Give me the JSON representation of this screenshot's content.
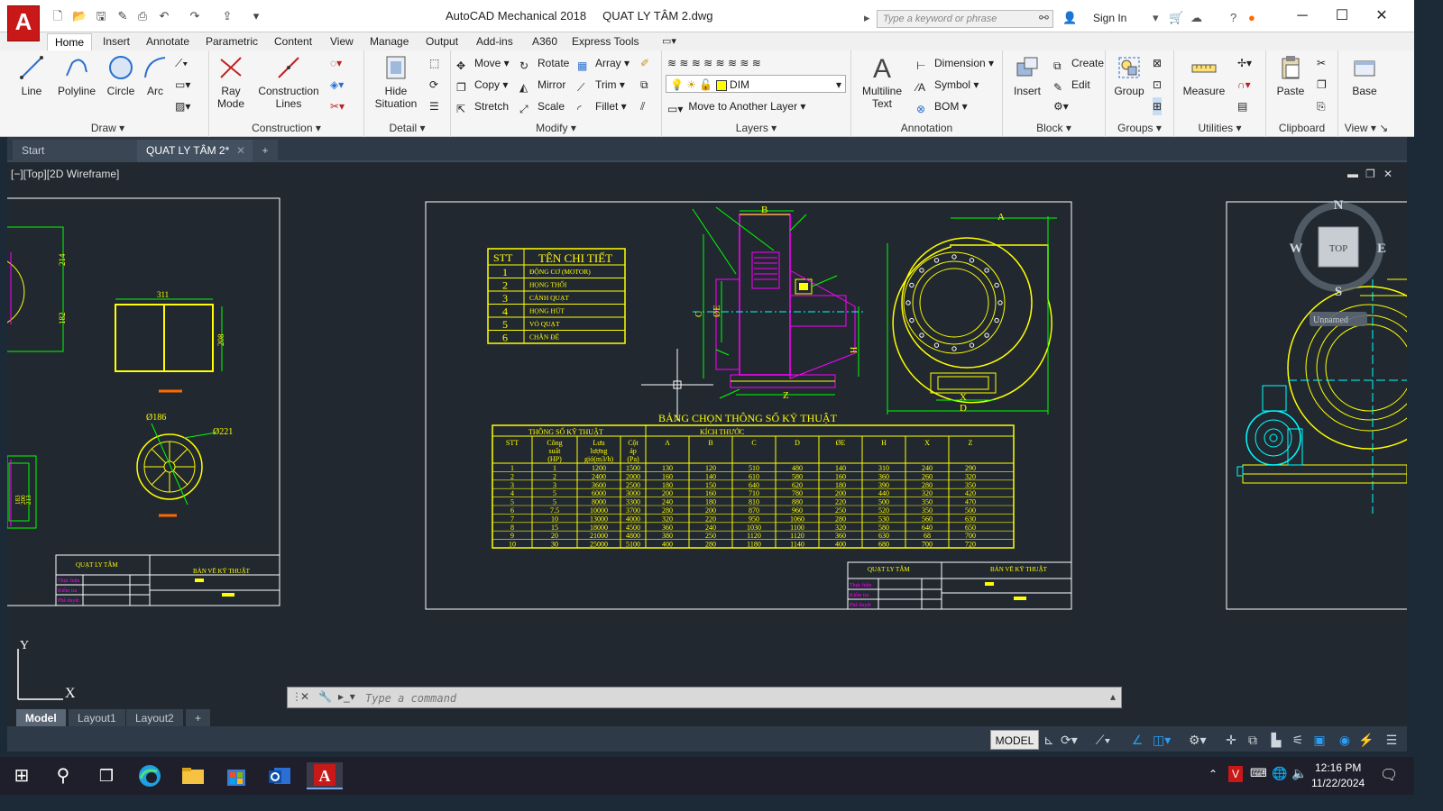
{
  "window": {
    "app_letter": "A",
    "title": "AutoCAD Mechanical 2018     QUAT LY TÂM 2.dwg",
    "search_placeholder": "Type a keyword or phrase",
    "sign_in": "Sign In"
  },
  "ribbon_tabs": [
    "Home",
    "Insert",
    "Annotate",
    "Parametric",
    "Content",
    "View",
    "Manage",
    "Output",
    "Add-ins",
    "A360",
    "Express Tools"
  ],
  "ribbon": {
    "draw": {
      "label": "Draw",
      "line": "Line",
      "polyline": "Polyline",
      "circle": "Circle",
      "arc": "Arc"
    },
    "construction": {
      "label": "Construction",
      "ray_1": "Ray",
      "ray_2": "Mode",
      "cl_1": "Construction",
      "cl_2": "Lines"
    },
    "detail": {
      "label": "Detail",
      "hide_1": "Hide",
      "hide_2": "Situation"
    },
    "modify": {
      "label": "Modify",
      "move": "Move",
      "rotate": "Rotate",
      "array": "Array",
      "copy": "Copy",
      "mirror": "Mirror",
      "trim": "Trim",
      "stretch": "Stretch",
      "scale": "Scale",
      "fillet": "Fillet"
    },
    "layers": {
      "label": "Layers",
      "current_layer": "DIM",
      "move_to_layer": "Move to Another Layer"
    },
    "annotation": {
      "label": "Annotation",
      "mtext_1": "Multiline",
      "mtext_2": "Text",
      "dimension": "Dimension",
      "symbol": "Symbol",
      "bom": "BOM"
    },
    "block": {
      "label": "Block",
      "insert": "Insert",
      "create": "Create",
      "edit": "Edit"
    },
    "groups": {
      "label": "Groups",
      "group": "Group"
    },
    "utilities": {
      "label": "Utilities",
      "measure": "Measure"
    },
    "clipboard": {
      "label": "Clipboard",
      "paste": "Paste"
    },
    "view": {
      "label": "View",
      "base": "Base"
    }
  },
  "doc_tabs": {
    "start": "Start",
    "active": "QUAT LY TÂM 2*"
  },
  "viewport": {
    "label": "[−][Top][2D Wireframe]",
    "viewcube": {
      "n": "N",
      "s": "S",
      "e": "E",
      "w": "W",
      "top": "TOP",
      "wcs": "Unnamed"
    },
    "ucs": {
      "x": "X",
      "y": "Y"
    }
  },
  "drawing": {
    "parts_table": {
      "headers": [
        "STT",
        "TÊN CHI TIẾT"
      ],
      "rows": [
        [
          "1",
          "ĐỘNG CƠ (MOTOR)"
        ],
        [
          "2",
          "HỌNG THỔI"
        ],
        [
          "3",
          "CÁNH QUẠT"
        ],
        [
          "4",
          "HỌNG HÚT"
        ],
        [
          "5",
          "VỎ QUẠT"
        ],
        [
          "6",
          "CHÂN ĐẾ"
        ]
      ]
    },
    "spec_title": "BẢNG CHỌN THÔNG SỐ KỸ THUẬT",
    "spec_group_1": "THÔNG SỐ KỸ THUẬT",
    "spec_group_2": "KÍCH THƯỚC",
    "spec_headers": [
      "STT",
      "Công suất (HP)",
      "Lưu lượng gió(m3/h)",
      "Cột áp (Pa)",
      "A",
      "B",
      "C",
      "D",
      "ØE",
      "H",
      "X",
      "Z"
    ],
    "spec_rows": [
      [
        "1",
        "1",
        "1200",
        "1500",
        "130",
        "120",
        "510",
        "480",
        "140",
        "310",
        "240",
        "290"
      ],
      [
        "2",
        "2",
        "2400",
        "2000",
        "160",
        "140",
        "610",
        "580",
        "160",
        "360",
        "260",
        "320"
      ],
      [
        "3",
        "3",
        "3600",
        "2500",
        "180",
        "150",
        "640",
        "620",
        "180",
        "390",
        "280",
        "350"
      ],
      [
        "4",
        "5",
        "6000",
        "3000",
        "200",
        "160",
        "710",
        "780",
        "200",
        "440",
        "320",
        "420"
      ],
      [
        "5",
        "5",
        "8000",
        "3300",
        "240",
        "180",
        "810",
        "880",
        "220",
        "500",
        "350",
        "470"
      ],
      [
        "6",
        "7.5",
        "10000",
        "3700",
        "280",
        "200",
        "870",
        "960",
        "250",
        "520",
        "350",
        "500"
      ],
      [
        "7",
        "10",
        "13000",
        "4000",
        "320",
        "220",
        "950",
        "1060",
        "280",
        "530",
        "560",
        "630"
      ],
      [
        "8",
        "15",
        "18000",
        "4500",
        "360",
        "240",
        "1030",
        "1100",
        "320",
        "580",
        "640",
        "650"
      ],
      [
        "9",
        "20",
        "21000",
        "4800",
        "380",
        "250",
        "1120",
        "1120",
        "360",
        "630",
        "68",
        "700"
      ],
      [
        "10",
        "30",
        "25000",
        "5100",
        "400",
        "280",
        "1180",
        "1140",
        "400",
        "680",
        "700",
        "720"
      ]
    ],
    "title_block": {
      "project": "QUẠT LY TÂM",
      "sheet": "BẢN VẼ KỸ THUẬT",
      "row1": "Thực hiện",
      "row2": "Kiểm tra",
      "row3": "Phê duyệt"
    },
    "dim_labels": {
      "A": "A",
      "B": "B",
      "C": "C",
      "D": "D",
      "E": "ØE",
      "H": "H",
      "X": "X",
      "Z": "Z"
    },
    "left_sheet": {
      "dim_311": "311",
      "dim_214": "214",
      "dim_182": "182",
      "dim_208": "208",
      "dim_186": "Ø186",
      "dim_221": "Ø221",
      "dim_183": "183",
      "dim_200": "200",
      "dim_213": "213"
    }
  },
  "command_line": {
    "placeholder": "Type a command"
  },
  "layout_tabs": [
    "Model",
    "Layout1",
    "Layout2"
  ],
  "status_bar": {
    "model": "MODEL"
  },
  "taskbar": {
    "time": "12:16 PM",
    "date": "11/22/2024"
  },
  "colors": {
    "yellow": "#ffff00",
    "magenta": "#ff00ff",
    "cyan": "#00ffff",
    "green": "#00ff00",
    "white": "#ffffff",
    "app_red": "#c81818"
  }
}
